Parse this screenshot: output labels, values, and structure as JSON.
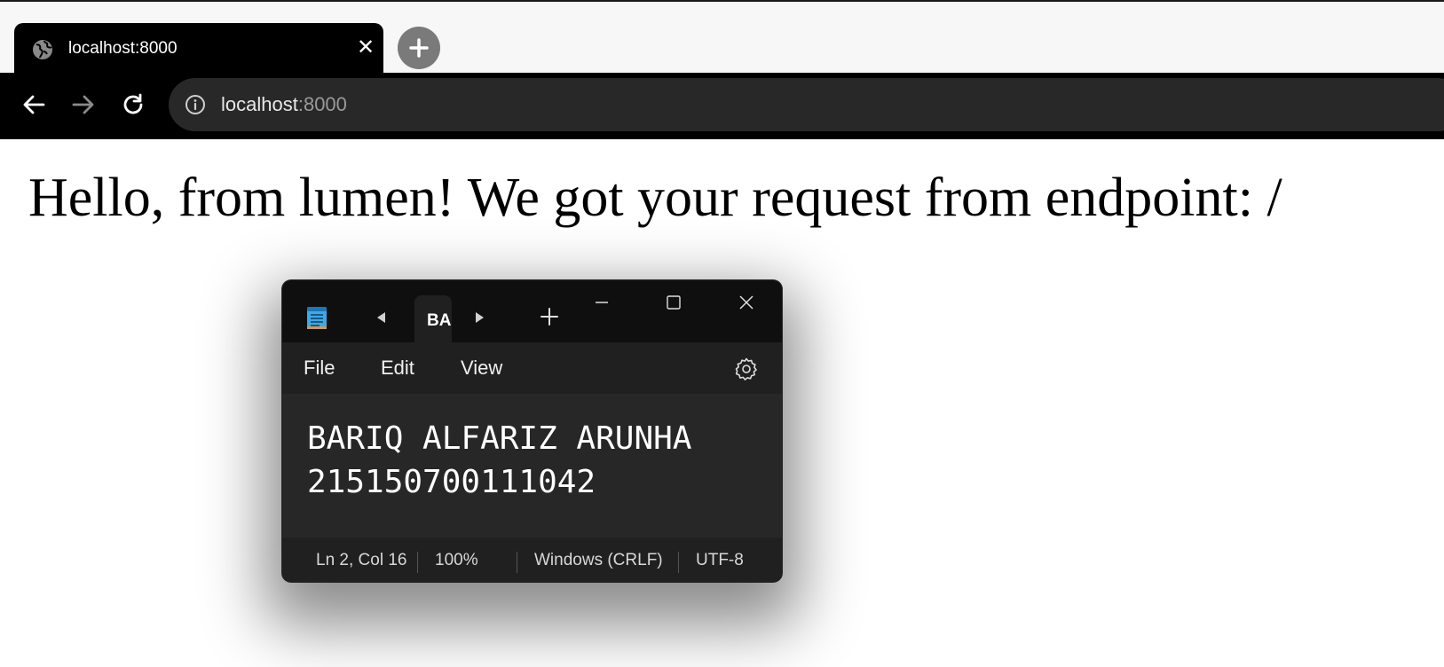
{
  "browser": {
    "tab": {
      "title": "localhost:8000",
      "icon": "globe-icon",
      "close_symbol": "✕"
    },
    "new_tab_icon": "plus-icon",
    "nav": {
      "back_icon": "arrow-left-icon",
      "forward_icon": "arrow-right-icon",
      "reload_icon": "reload-icon"
    },
    "address": {
      "host": "localhost",
      "port": ":8000",
      "icon": "info-icon"
    }
  },
  "page": {
    "heading": "Hello, from lumen! We got your request from endpoint: /"
  },
  "notepad": {
    "app_icon": "notepad-icon",
    "tab_label": "BARIQ ALFARIZ ARUNHA",
    "menu": [
      "File",
      "Edit",
      "View"
    ],
    "settings_icon": "gear-icon",
    "content_lines": [
      "BARIQ ALFARIZ ARUNHA",
      "215150700111042"
    ],
    "status": {
      "position": "Ln 2, Col 16",
      "zoom": "100%",
      "line_ending": "Windows (CRLF)",
      "encoding": "UTF-8"
    }
  },
  "colors": {
    "browser_chrome": "#000000",
    "omnibox": "#282828",
    "notepad_titlebar": "#0f0f0f",
    "notepad_body": "#202020"
  }
}
